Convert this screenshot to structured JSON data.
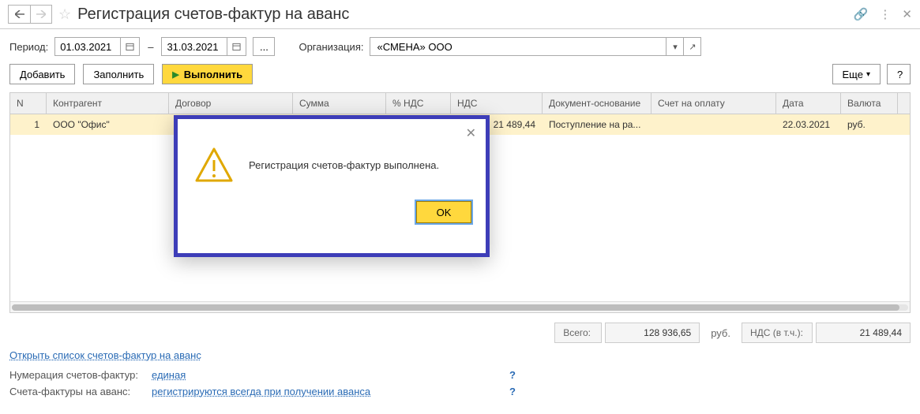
{
  "header": {
    "title": "Регистрация счетов-фактур на аванс"
  },
  "filter": {
    "period_label": "Период:",
    "date_from": "01.03.2021",
    "date_to": "31.03.2021",
    "dash": "–",
    "ellipsis": "...",
    "org_label": "Организация:",
    "org_value": "«СМЕНА» ООО"
  },
  "toolbar": {
    "add": "Добавить",
    "fill": "Заполнить",
    "execute": "Выполнить",
    "more": "Еще",
    "help": "?"
  },
  "table": {
    "headers": {
      "n": "N",
      "contragent": "Контрагент",
      "договор": "Договор",
      "sum": "Сумма",
      "pct_nds": "% НДС",
      "nds": "НДС",
      "doc_base": "Документ-основание",
      "schet": "Счет на оплату",
      "date": "Дата",
      "currency": "Валюта"
    },
    "rows": [
      {
        "n": "1",
        "contragent": "ООО \"Офис\"",
        "nds": "21 489,44",
        "doc_base": "Поступление на ра...",
        "date": "22.03.2021",
        "currency": "руб."
      }
    ]
  },
  "totals": {
    "label_total": "Всего:",
    "total_value": "128 936,65",
    "unit": "руб.",
    "label_nds": "НДС (в т.ч.):",
    "nds_value": "21 489,44"
  },
  "links": {
    "open_sf_list": "Открыть список счетов-фактур на аванс"
  },
  "settings": {
    "row1_label": "Нумерация счетов-фактур:",
    "row1_value": "единая",
    "row2_label": "Счета-фактуры на аванс:",
    "row2_value": "регистрируются всегда при получении аванса",
    "help": "?"
  },
  "dialog": {
    "message": "Регистрация счетов-фактур выполнена.",
    "ok": "OK",
    "close": "✕"
  }
}
